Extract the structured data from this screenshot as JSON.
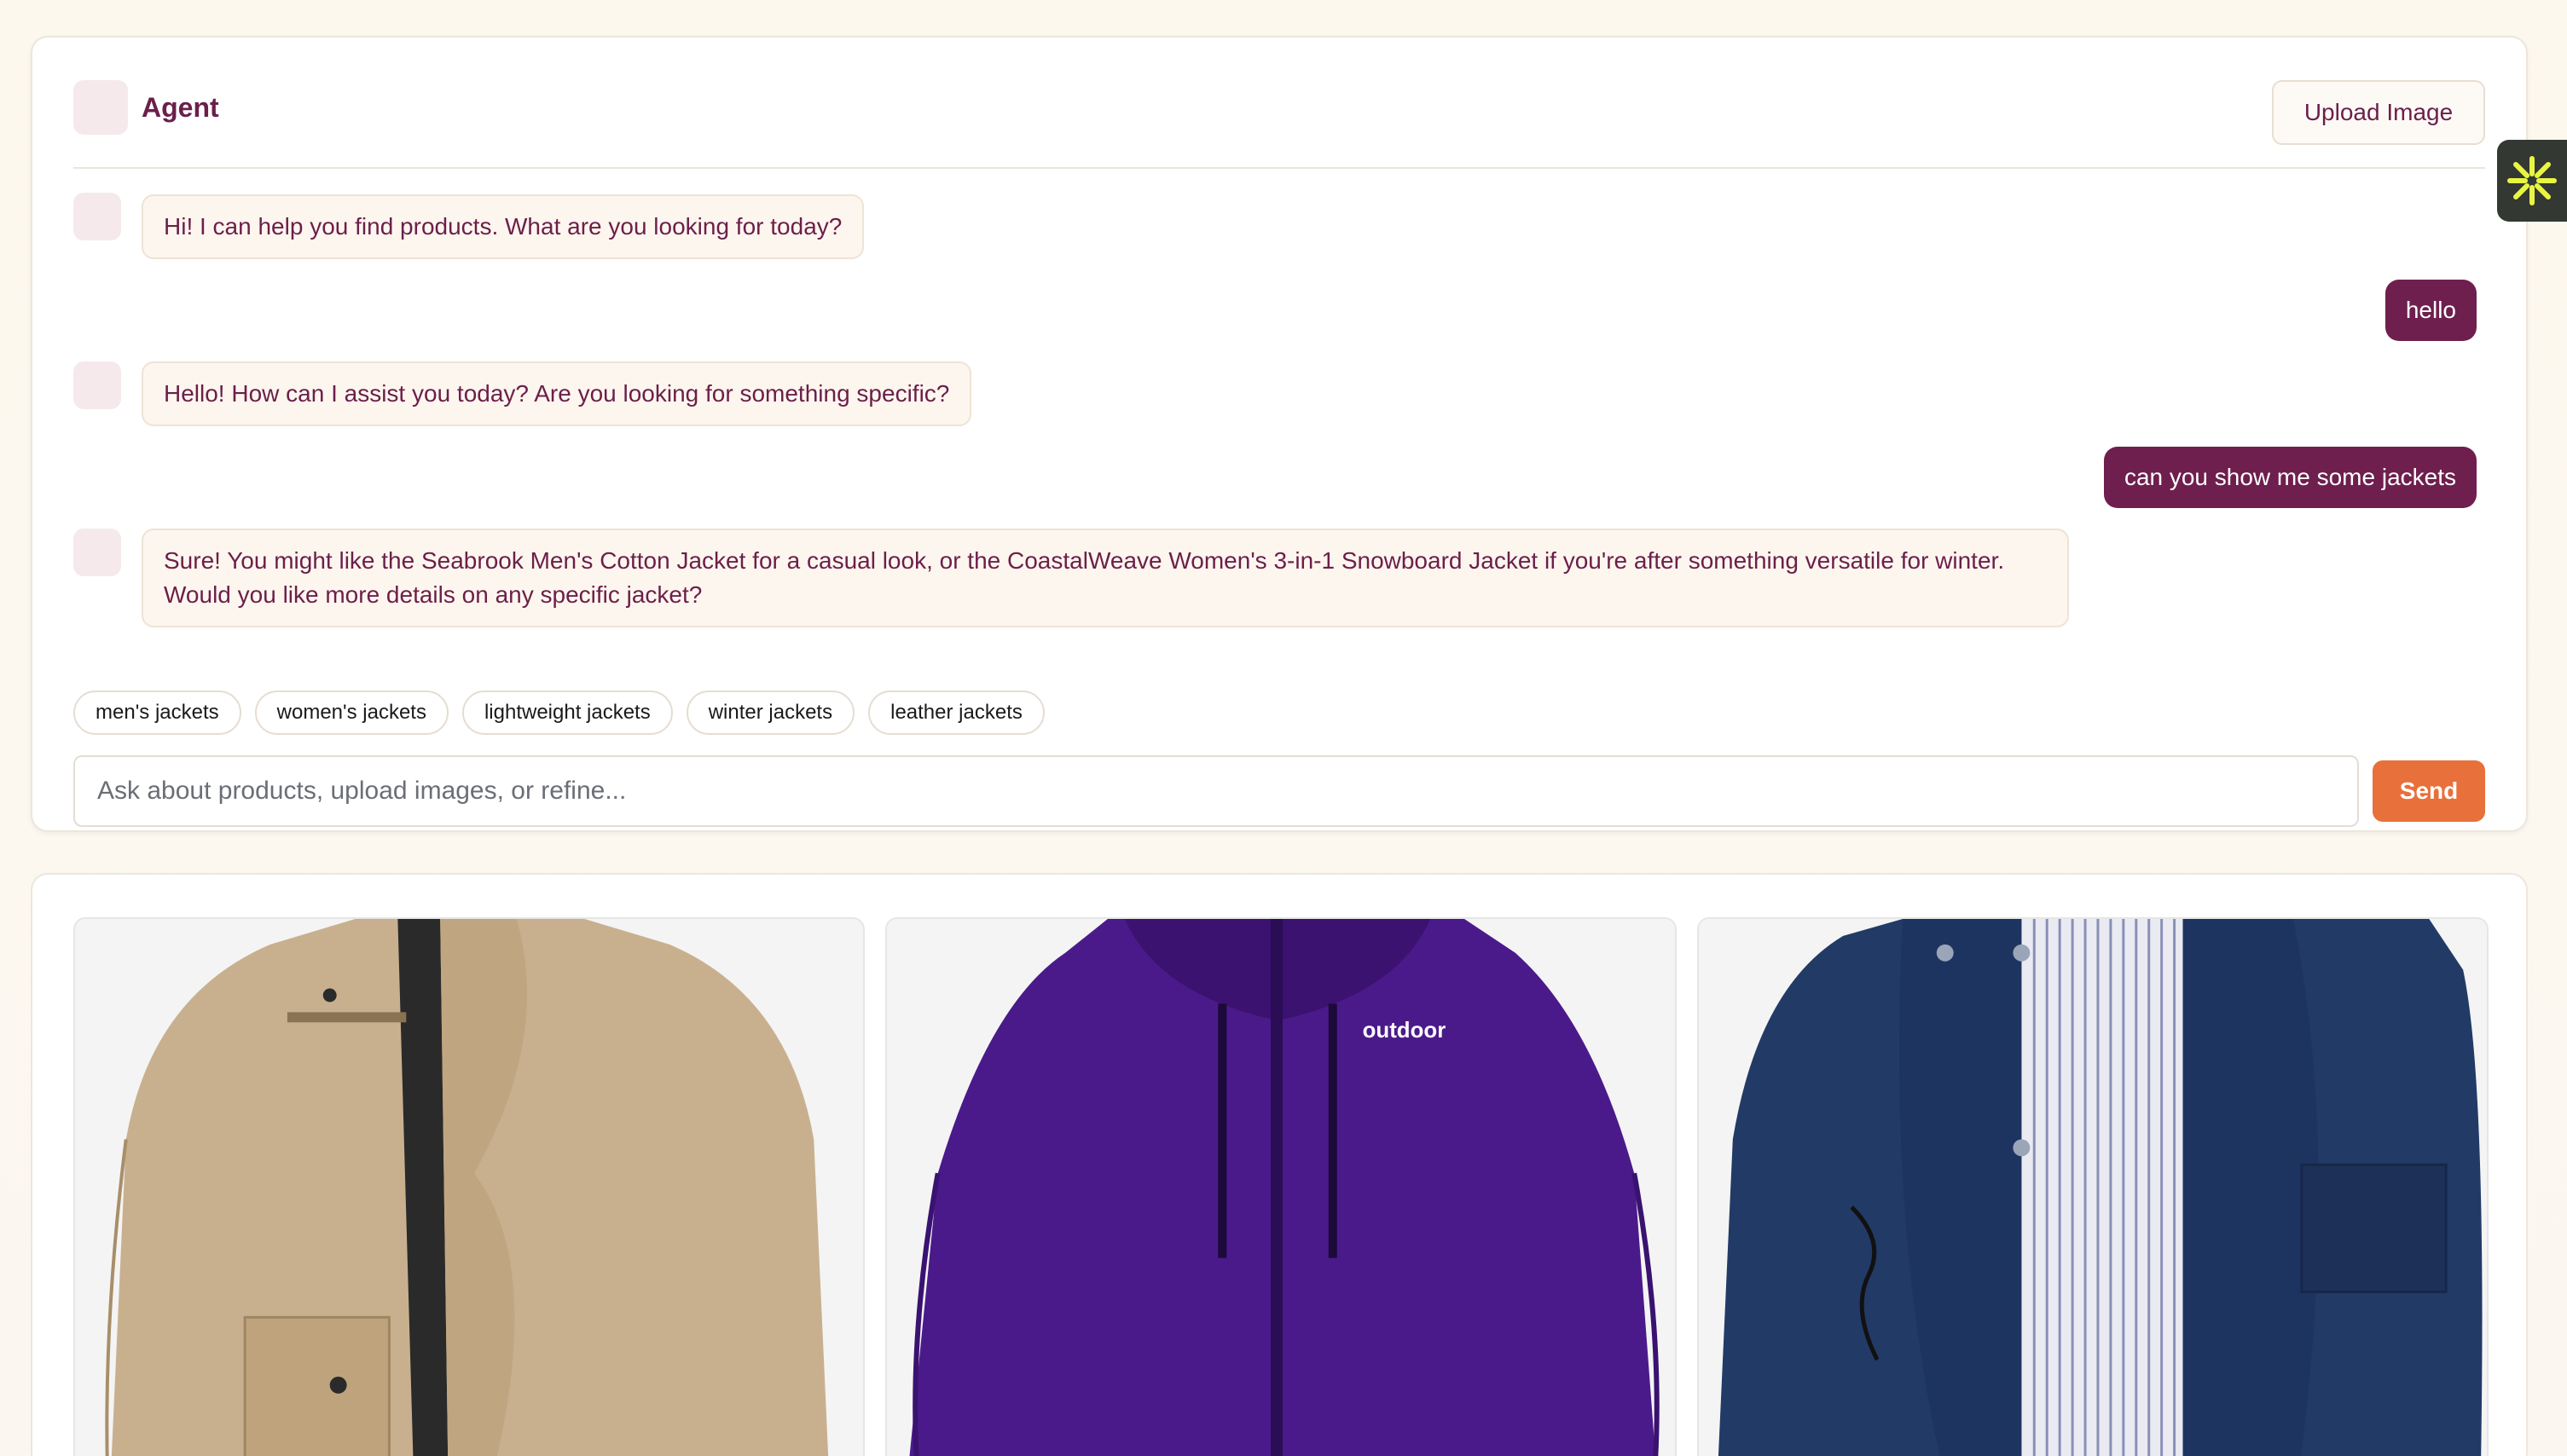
{
  "header": {
    "agent_label": "Agent",
    "upload_label": "Upload Image"
  },
  "messages": [
    {
      "role": "assistant",
      "text": "Hi! I can help you find products. What are you looking for today?"
    },
    {
      "role": "user",
      "text": "hello"
    },
    {
      "role": "assistant",
      "text": "Hello! How can I assist you today? Are you looking for something specific?"
    },
    {
      "role": "user",
      "text": "can you show me some jackets"
    },
    {
      "role": "assistant",
      "text": "Sure! You might like the Seabrook Men's Cotton Jacket for a casual look, or the CoastalWeave Women's 3-in-1 Snowboard Jacket if you're after something versatile for winter. Would you like more details on any specific jacket?"
    }
  ],
  "suggestions": [
    "men's jackets",
    "women's jackets",
    "lightweight jackets",
    "winter jackets",
    "leather jackets"
  ],
  "composer": {
    "placeholder": "Ask about products, upload images, or refine...",
    "send_label": "Send"
  },
  "products": [
    {
      "image": "khaki-cotton-jacket",
      "color": "#c8b08f"
    },
    {
      "image": "purple-hooded-jacket",
      "print": "outdoor",
      "color": "#4a1a8a"
    },
    {
      "image": "navy-utility-jacket",
      "color": "#223a66"
    }
  ],
  "colors": {
    "brand": "#6b1f4a",
    "send": "#e8703a",
    "user_bubble": "#6e1f4e"
  },
  "side_widget_icon": "asterisk-icon"
}
